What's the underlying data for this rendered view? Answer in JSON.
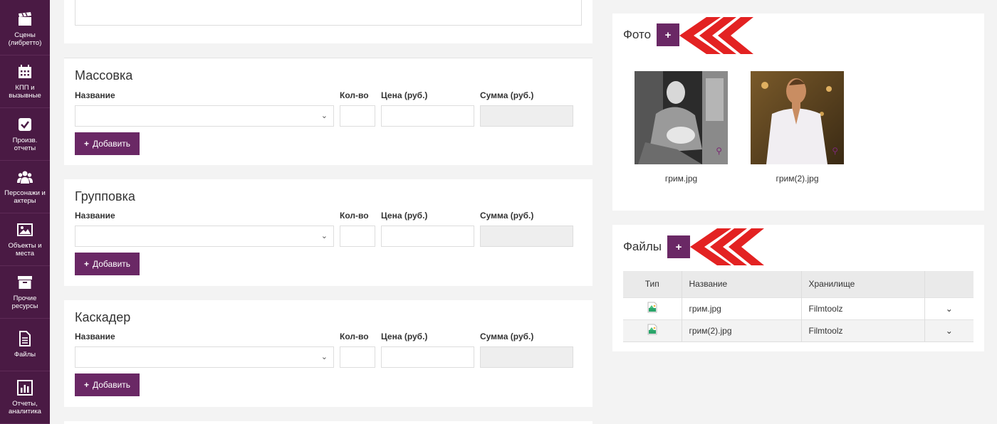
{
  "sidebar": {
    "items": [
      {
        "label": "Сцены\n(либретто)",
        "icon": "clapperboard-icon"
      },
      {
        "label": "КПП и\nвызывные",
        "icon": "calendar-icon"
      },
      {
        "label": "Произв.\nотчеты",
        "icon": "checkbox-icon"
      },
      {
        "label": "Персонажи и\nактеры",
        "icon": "people-icon"
      },
      {
        "label": "Объекты и\nместа",
        "icon": "image-icon"
      },
      {
        "label": "Прочие\nресурсы",
        "icon": "archive-icon"
      },
      {
        "label": "Файлы",
        "icon": "file-icon"
      },
      {
        "label": "Отчеты,\nаналитика",
        "icon": "bar-chart-icon"
      }
    ]
  },
  "sections": [
    {
      "title": "Массовка",
      "col_name": "Название",
      "col_qty": "Кол-во",
      "col_price": "Цена (руб.)",
      "col_sum": "Сумма (руб.)",
      "add_label": "Добавить"
    },
    {
      "title": "Групповка",
      "col_name": "Название",
      "col_qty": "Кол-во",
      "col_price": "Цена (руб.)",
      "col_sum": "Сумма (руб.)",
      "add_label": "Добавить"
    },
    {
      "title": "Каскадер",
      "col_name": "Название",
      "col_qty": "Кол-во",
      "col_price": "Цена (руб.)",
      "col_sum": "Сумма (руб.)",
      "add_label": "Добавить"
    }
  ],
  "photo": {
    "title": "Фото",
    "add_symbol": "+",
    "items": [
      {
        "caption": "грим.jpg"
      },
      {
        "caption": "грим(2).jpg"
      }
    ]
  },
  "files": {
    "title": "Файлы",
    "add_symbol": "+",
    "headers": [
      "Тип",
      "Название",
      "Хранилище",
      ""
    ],
    "rows": [
      {
        "name": "грим.jpg",
        "storage": "Filmtoolz"
      },
      {
        "name": "грим(2).jpg",
        "storage": "Filmtoolz"
      }
    ]
  },
  "colors": {
    "accent": "#6a2865",
    "sidebar": "#4a1a44",
    "arrow": "#e32222"
  }
}
